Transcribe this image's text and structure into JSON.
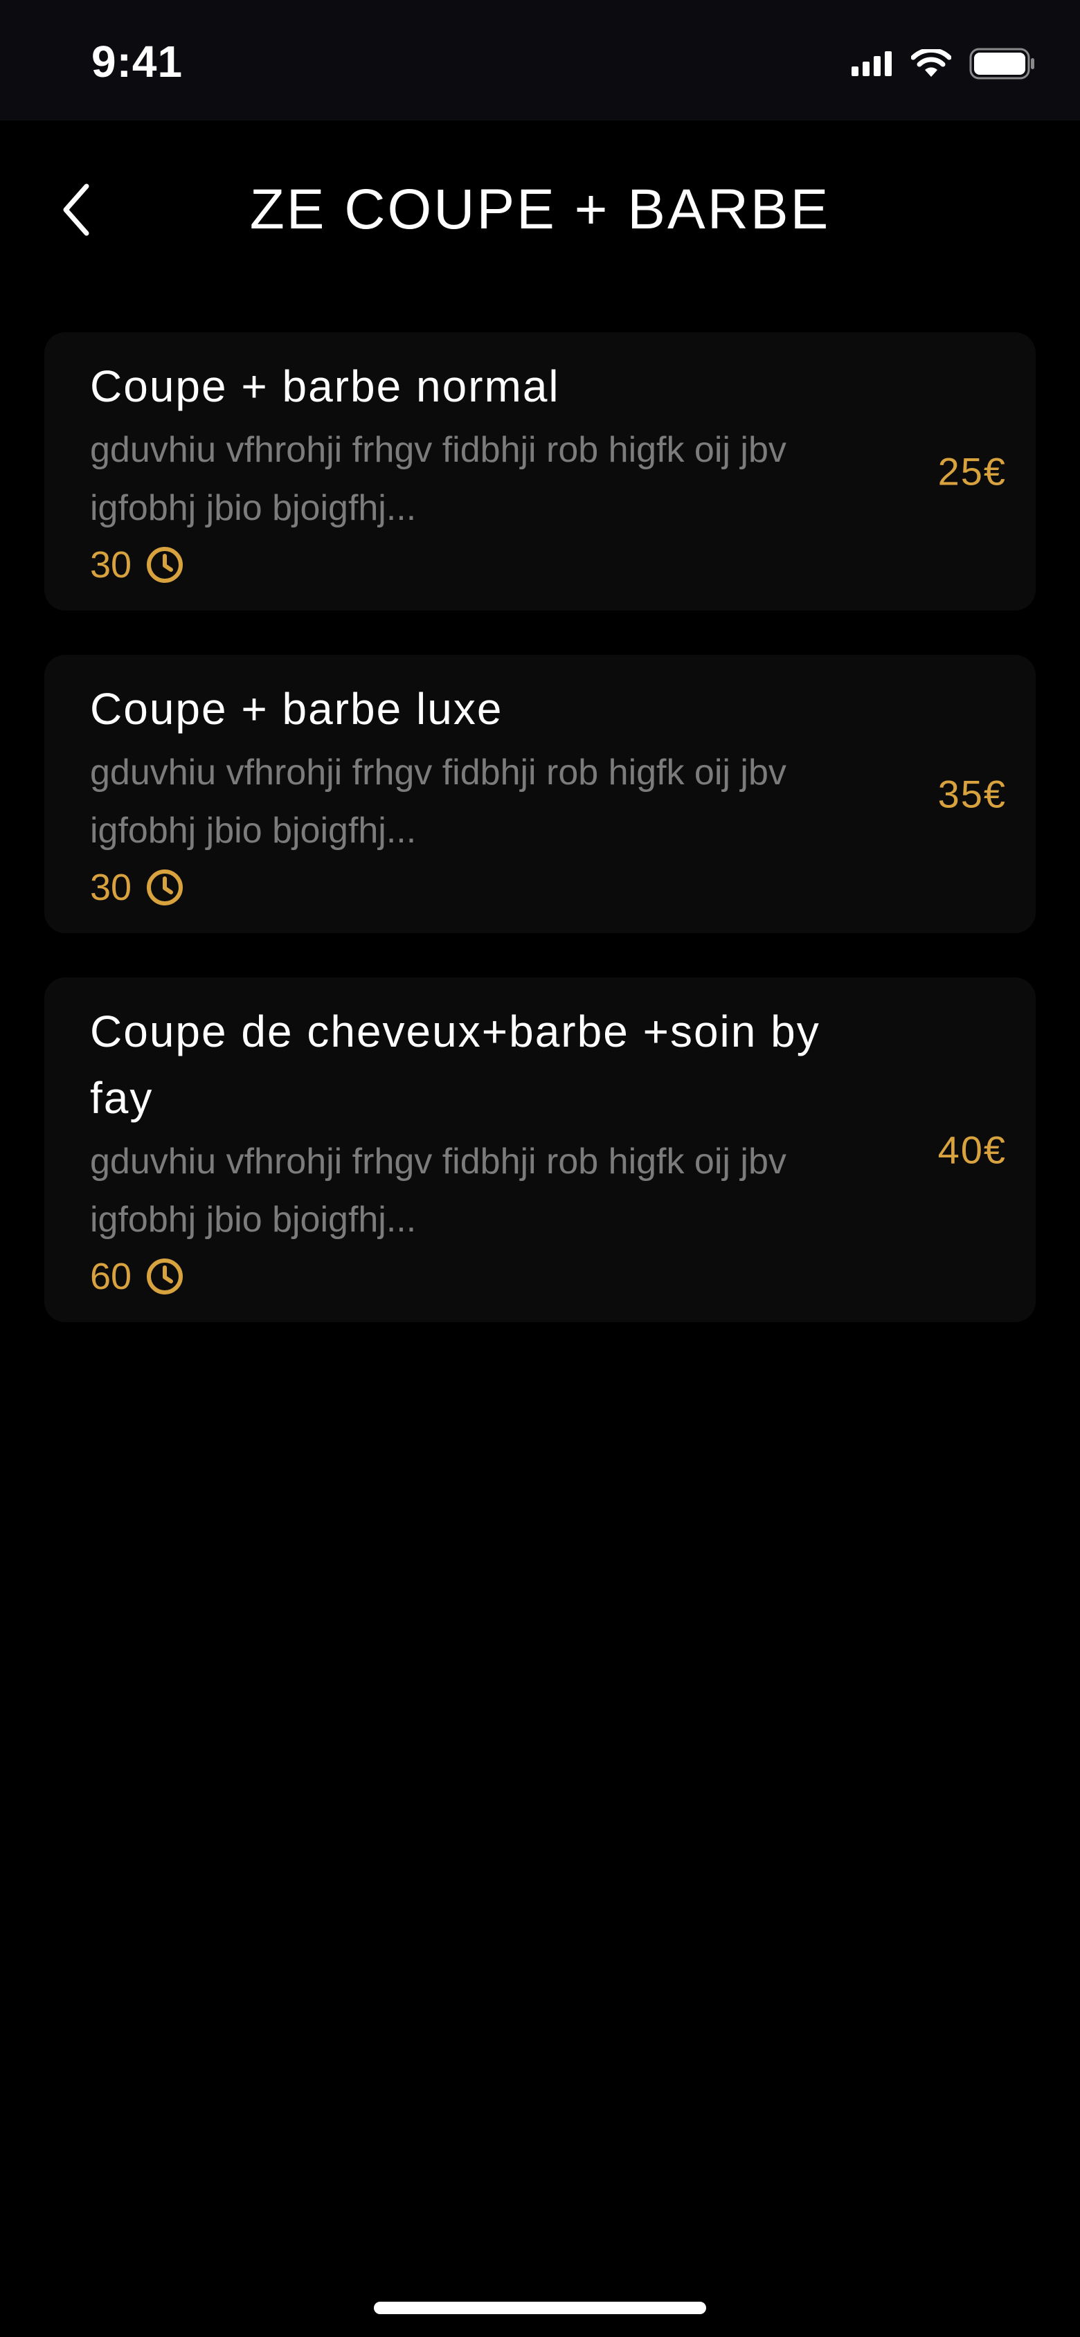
{
  "status_bar": {
    "time": "9:41"
  },
  "header": {
    "title": "ZE COUPE + BARBE",
    "back_icon": "chevron-left-icon"
  },
  "services": [
    {
      "name": "Coupe + barbe normal",
      "description": "gduvhiu vfhrohji frhgv fidbhji rob higfk oij jbv igfobhj jbio bjoigfhj...",
      "duration": "30",
      "price": "25€"
    },
    {
      "name": "Coupe + barbe luxe",
      "description": "gduvhiu vfhrohji frhgv fidbhji rob higfk oij jbv igfobhj jbio bjoigfhj...",
      "duration": "30",
      "price": "35€"
    },
    {
      "name": "Coupe de cheveux+barbe +soin by fay",
      "description": "gduvhiu vfhrohji frhgv fidbhji rob higfk oij jbv igfobhj jbio bjoigfhj...",
      "duration": "60",
      "price": "40€"
    }
  ],
  "colors": {
    "background": "#000000",
    "card": "#0b0b0b",
    "accent": "#d8a23f",
    "muted_text": "#7c7c7c",
    "text": "#ffffff"
  }
}
